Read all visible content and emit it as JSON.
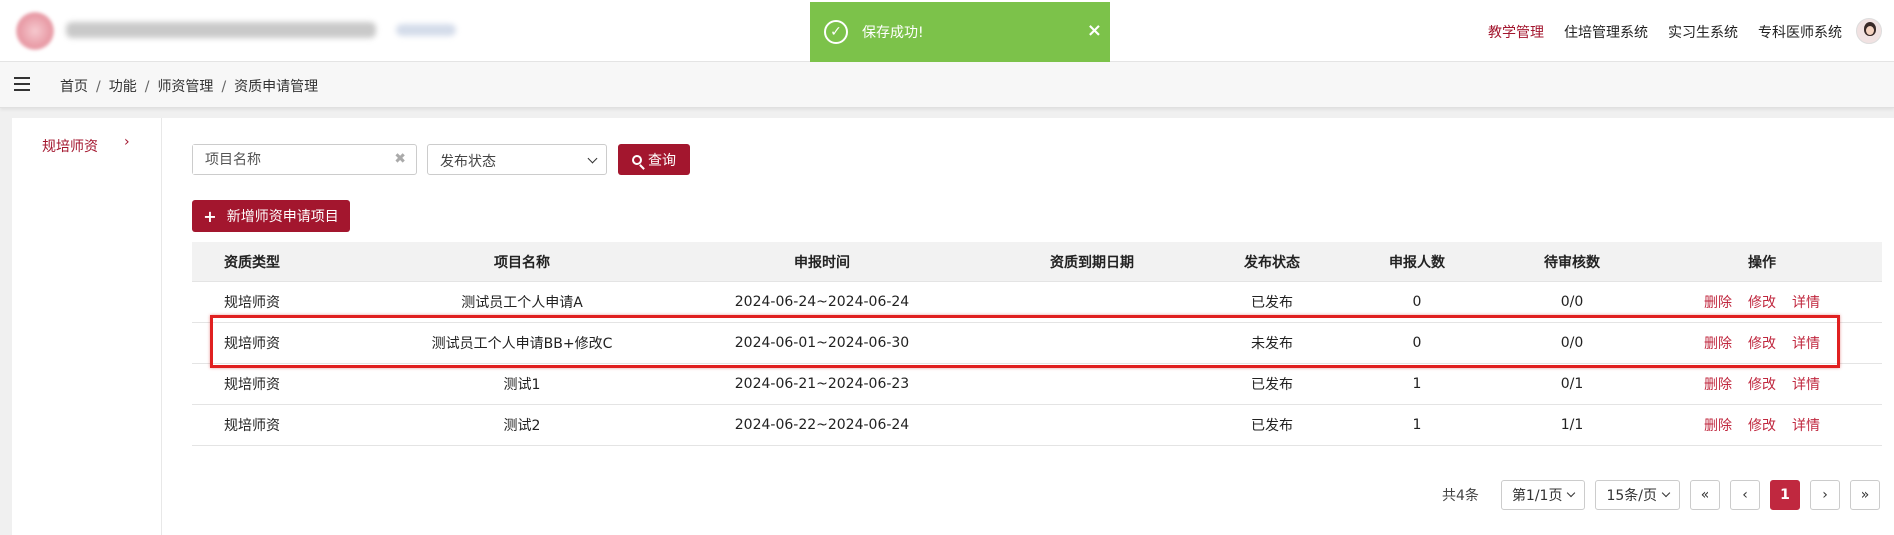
{
  "topnav": {
    "items": [
      "教学管理",
      "住培管理系统",
      "实习生系统",
      "专科医师系统"
    ],
    "active_index": 0
  },
  "toast": {
    "message": "保存成功!",
    "close_symbol": "×",
    "color": "#7cc24a"
  },
  "breadcrumb": [
    "首页",
    "功能",
    "师资管理",
    "资质申请管理"
  ],
  "sidebar": {
    "items": [
      {
        "label": "规培师资",
        "arrow": "›"
      }
    ]
  },
  "filters": {
    "project_placeholder": "项目名称",
    "status_select": "发布状态",
    "query_label": "查询"
  },
  "add_button": {
    "label": "新增师资申请项目"
  },
  "table": {
    "headers": [
      "资质类型",
      "项目名称",
      "申报时间",
      "资质到期日期",
      "发布状态",
      "申报人数",
      "待审核数",
      "操作"
    ],
    "rows": [
      {
        "type": "规培师资",
        "name": "测试员工个人申请A",
        "period": "2024-06-24~2024-06-24",
        "expiry": "",
        "status": "已发布",
        "applicants": "0",
        "pending": "0/0"
      },
      {
        "type": "规培师资",
        "name": "测试员工个人申请BB+修改C",
        "period": "2024-06-01~2024-06-30",
        "expiry": "",
        "status": "未发布",
        "applicants": "0",
        "pending": "0/0"
      },
      {
        "type": "规培师资",
        "name": "测试1",
        "period": "2024-06-21~2024-06-23",
        "expiry": "",
        "status": "已发布",
        "applicants": "1",
        "pending": "0/1"
      },
      {
        "type": "规培师资",
        "name": "测试2",
        "period": "2024-06-22~2024-06-24",
        "expiry": "",
        "status": "已发布",
        "applicants": "1",
        "pending": "1/1"
      }
    ],
    "actions": [
      "删除",
      "修改",
      "详情"
    ]
  },
  "pagination": {
    "total": "共4条",
    "page_select": "第1/1页",
    "size_select": "15条/页",
    "first": "«",
    "prev": "‹",
    "current": "1",
    "next": "›",
    "last": "»"
  },
  "colors": {
    "brand": "#a3162e",
    "link": "#c0283f",
    "highlight_border": "#e02020"
  }
}
